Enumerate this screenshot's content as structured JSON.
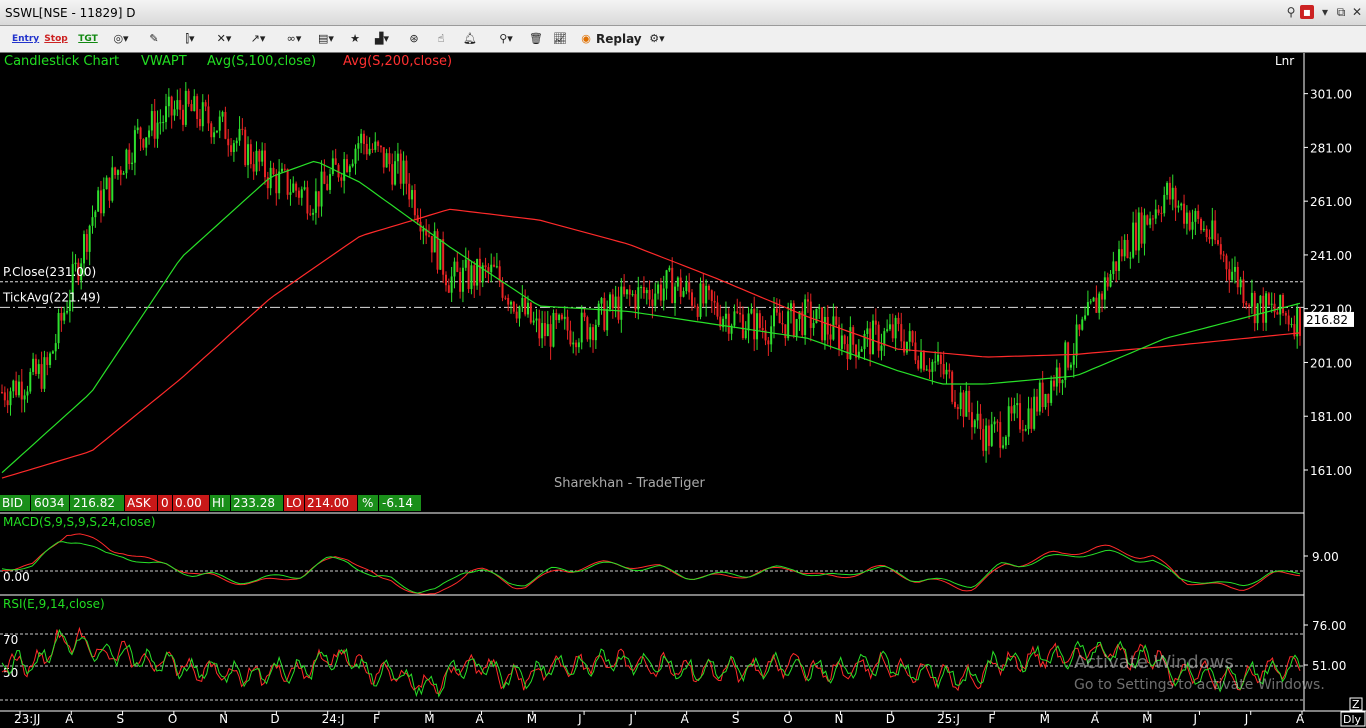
{
  "window": {
    "title": "SSWL[NSE - 11829] D"
  },
  "toolbar": {
    "entry_label": "Entry",
    "stop_label": "Stop",
    "tgt_label": "TGT",
    "replay_label": "Replay"
  },
  "legend": {
    "chart_type": "Candlestick Chart",
    "vwapt": "VWAPT",
    "avg100": "Avg(S,100,close)",
    "avg200": "Avg(S,200,close)",
    "scale_mode": "Lnr",
    "colors": {
      "vwapt": "#22dd22",
      "avg100": "#22dd22",
      "avg200": "#ff3030"
    }
  },
  "lines": {
    "prev_close": "P.Close(231.00)",
    "tick_avg": "TickAvg(221.49)",
    "last_price": "216.82"
  },
  "quote_bar": [
    {
      "label": "BID",
      "value": "6034",
      "extra": "216.82",
      "color": "#1a8f1a"
    },
    {
      "label": "ASK",
      "value": "0",
      "extra": "0.00",
      "color": "#c81818"
    },
    {
      "label": "HI",
      "value": "233.28",
      "color": "#1a8f1a"
    },
    {
      "label": "LO",
      "value": "214.00",
      "color": "#c81818"
    },
    {
      "label": "%",
      "value": "-6.14",
      "color": "#1a8f1a"
    }
  ],
  "watermark_text": "Sharekhan - TradeTiger",
  "macd": {
    "title": "MACD(S,9,S,9,S,24,close)",
    "zero_label": "0.00",
    "axis_label": "9.00"
  },
  "rsi": {
    "title": "RSI(E,9,14,close)",
    "level_70": "70",
    "level_50": "50",
    "axis": [
      "76.00",
      "51.00"
    ]
  },
  "corner": {
    "z": "Z",
    "period": "Dly"
  },
  "os_watermark": {
    "line1": "Activate Windows",
    "line2": "Go to Settings to activate Windows."
  },
  "chart_data": {
    "type": "candlestick",
    "y_ticks": [
      301,
      281,
      261,
      241,
      221,
      201,
      181,
      161
    ],
    "y_tick_labels": [
      "301.00",
      "281.00",
      "261.00",
      "241.00",
      "221.00",
      "201.00",
      "181.00",
      "161.00"
    ],
    "ylim": [
      145,
      315
    ],
    "prev_close": 231.0,
    "tick_avg": 221.49,
    "last": 216.82,
    "x_labels": [
      "23:JJ",
      "A",
      "S",
      "O",
      "N",
      "D",
      "24:J",
      "F",
      "M",
      "A",
      "M",
      "J",
      "J",
      "A",
      "S",
      "O",
      "N",
      "D",
      "25:J",
      "F",
      "M",
      "A",
      "M",
      "J",
      "J",
      "A"
    ],
    "price_path": [
      [
        0,
        190
      ],
      [
        1,
        198
      ],
      [
        2,
        255
      ],
      [
        3,
        285
      ],
      [
        4,
        296
      ],
      [
        5,
        288
      ],
      [
        6,
        270
      ],
      [
        7,
        262
      ],
      [
        8,
        284
      ],
      [
        9,
        270
      ],
      [
        10,
        232
      ],
      [
        11,
        234
      ],
      [
        12,
        212
      ],
      [
        13,
        214
      ],
      [
        14,
        225
      ],
      [
        15,
        230
      ],
      [
        16,
        220
      ],
      [
        17,
        214
      ],
      [
        18,
        218
      ],
      [
        19,
        208
      ],
      [
        20,
        212
      ],
      [
        21,
        198
      ],
      [
        22,
        173
      ],
      [
        23,
        183
      ],
      [
        24,
        208
      ],
      [
        25,
        242
      ],
      [
        26,
        264
      ],
      [
        27,
        248
      ],
      [
        28,
        222
      ],
      [
        29,
        217
      ]
    ],
    "avg100_path": [
      [
        0,
        160
      ],
      [
        2,
        190
      ],
      [
        4,
        240
      ],
      [
        6,
        270
      ],
      [
        7,
        276
      ],
      [
        8,
        268
      ],
      [
        10,
        244
      ],
      [
        12,
        222
      ],
      [
        14,
        220
      ],
      [
        16,
        215
      ],
      [
        18,
        210
      ],
      [
        20,
        198
      ],
      [
        21,
        193
      ],
      [
        22,
        193
      ],
      [
        24,
        196
      ],
      [
        26,
        210
      ],
      [
        29,
        223
      ]
    ],
    "avg200_path": [
      [
        0,
        158
      ],
      [
        2,
        168
      ],
      [
        4,
        195
      ],
      [
        6,
        225
      ],
      [
        8,
        248
      ],
      [
        10,
        258
      ],
      [
        12,
        254
      ],
      [
        14,
        245
      ],
      [
        16,
        232
      ],
      [
        18,
        218
      ],
      [
        20,
        206
      ],
      [
        22,
        203
      ],
      [
        24,
        204
      ],
      [
        26,
        207
      ],
      [
        29,
        212
      ]
    ]
  }
}
